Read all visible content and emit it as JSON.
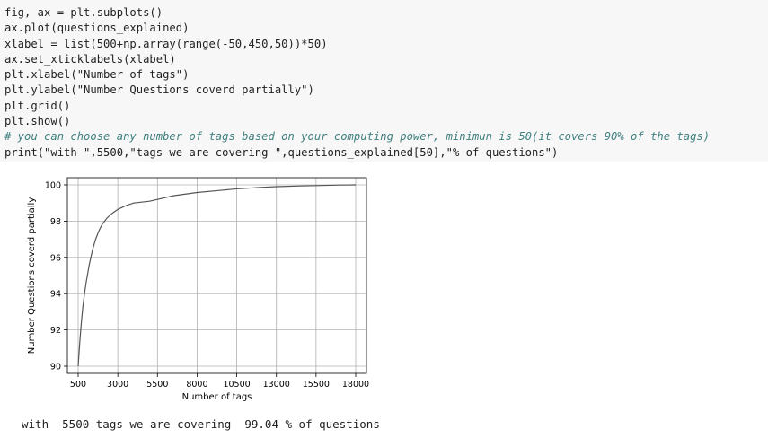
{
  "code_cell": {
    "lines": [
      "fig, ax = plt.subplots()",
      "ax.plot(questions_explained)",
      "xlabel = list(500+np.array(range(-50,450,50))*50)",
      "ax.set_xticklabels(xlabel)",
      "plt.xlabel(\"Number of tags\")",
      "plt.ylabel(\"Number Questions coverd partially\")",
      "plt.grid()",
      "plt.show()",
      "# you can choose any number of tags based on your computing power, minimun is 50(it covers 90% of the tags)",
      "print(\"with \",5500,\"tags we are covering \",questions_explained[50],\"% of questions\")"
    ]
  },
  "chart_data": {
    "type": "line",
    "title": "",
    "xlabel": "Number of tags",
    "ylabel": "Number Questions coverd partially",
    "xtick_labels": [
      "500",
      "3000",
      "5500",
      "8000",
      "10500",
      "13000",
      "15500",
      "18000"
    ],
    "xlim": [
      500,
      18000
    ],
    "ylim": [
      90,
      100
    ],
    "yticks": [
      90,
      92,
      94,
      96,
      98,
      100
    ],
    "grid": true,
    "line_color": "#555555",
    "series": [
      {
        "x": [
          500,
          600,
          700,
          800,
          900,
          1000,
          1200,
          1400,
          1600,
          1800,
          2000,
          2300,
          2600,
          3000,
          3500,
          4000,
          5000,
          5500,
          6500,
          8000,
          9500,
          10500,
          12000,
          13000,
          14500,
          15500,
          17000,
          18000
        ],
        "y": [
          90.0,
          91.3,
          92.4,
          93.3,
          94.0,
          94.6,
          95.6,
          96.4,
          97.0,
          97.45,
          97.8,
          98.15,
          98.4,
          98.65,
          98.85,
          99.0,
          99.1,
          99.2,
          99.4,
          99.58,
          99.7,
          99.78,
          99.86,
          99.9,
          99.94,
          99.96,
          99.99,
          100.0
        ]
      }
    ]
  },
  "output": {
    "text": "with  5500 tags we are covering  99.04 % of questions"
  }
}
